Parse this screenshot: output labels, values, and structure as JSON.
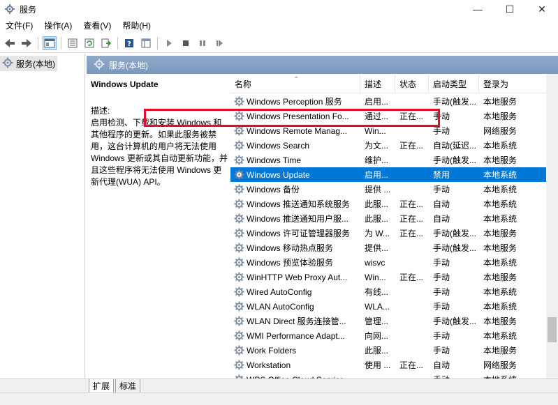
{
  "window": {
    "title": "服务",
    "controls": {
      "minimize": "—",
      "maximize": "☐",
      "close": "✕"
    }
  },
  "menu": [
    "文件(F)",
    "操作(A)",
    "查看(V)",
    "帮助(H)"
  ],
  "toolbar_icons": [
    "back-arrow-icon",
    "forward-arrow-icon",
    "console-tree-icon",
    "properties-icon",
    "refresh-icon",
    "export-icon",
    "help-icon",
    "view-icon",
    "play-icon",
    "stop-icon",
    "pause-icon",
    "restart-icon"
  ],
  "tree": {
    "root_label": "服务(本地)"
  },
  "panel": {
    "header_label": "服务(本地)",
    "selected_service": "Windows Update",
    "description_label": "描述:",
    "description_text": "启用检测、下载和安装 Windows 和其他程序的更新。如果此服务被禁用，这台计算机的用户将无法使用 Windows 更新或其自动更新功能，并且这些程序将无法使用 Windows 更新代理(WUA) API。"
  },
  "table": {
    "columns": [
      "名称",
      "描述",
      "状态",
      "启动类型",
      "登录为"
    ],
    "rows": [
      {
        "name": "Windows Perception 服务",
        "desc": "启用...",
        "status": "",
        "start": "手动(触发...",
        "logon": "本地服务"
      },
      {
        "name": "Windows Presentation Fo...",
        "desc": "通过...",
        "status": "正在...",
        "start": "手动",
        "logon": "本地服务"
      },
      {
        "name": "Windows Remote Manag...",
        "desc": "Win...",
        "status": "",
        "start": "手动",
        "logon": "网络服务"
      },
      {
        "name": "Windows Search",
        "desc": "为文...",
        "status": "正在...",
        "start": "自动(延迟...",
        "logon": "本地系统"
      },
      {
        "name": "Windows Time",
        "desc": "维护...",
        "status": "",
        "start": "手动(触发...",
        "logon": "本地服务"
      },
      {
        "name": "Windows Update",
        "desc": "启用...",
        "status": "",
        "start": "禁用",
        "logon": "本地系统"
      },
      {
        "name": "Windows 备份",
        "desc": "提供 ...",
        "status": "",
        "start": "手动",
        "logon": "本地系统"
      },
      {
        "name": "Windows 推送通知系统服务",
        "desc": "此服...",
        "status": "正在...",
        "start": "自动",
        "logon": "本地系统"
      },
      {
        "name": "Windows 推送通知用户服...",
        "desc": "此服...",
        "status": "正在...",
        "start": "自动",
        "logon": "本地系统"
      },
      {
        "name": "Windows 许可证管理器服务",
        "desc": "为 W...",
        "status": "正在...",
        "start": "手动(触发...",
        "logon": "本地服务"
      },
      {
        "name": "Windows 移动热点服务",
        "desc": "提供...",
        "status": "",
        "start": "手动(触发...",
        "logon": "本地服务"
      },
      {
        "name": "Windows 预览体验服务",
        "desc": "wisvc",
        "status": "",
        "start": "手动",
        "logon": "本地系统"
      },
      {
        "name": "WinHTTP Web Proxy Aut...",
        "desc": "Win...",
        "status": "正在...",
        "start": "手动",
        "logon": "本地服务"
      },
      {
        "name": "Wired AutoConfig",
        "desc": "有线...",
        "status": "",
        "start": "手动",
        "logon": "本地系统"
      },
      {
        "name": "WLAN AutoConfig",
        "desc": "WLA...",
        "status": "",
        "start": "手动",
        "logon": "本地系统"
      },
      {
        "name": "WLAN Direct 服务连接管...",
        "desc": "管理...",
        "status": "",
        "start": "手动(触发...",
        "logon": "本地服务"
      },
      {
        "name": "WMI Performance Adapt...",
        "desc": "向网...",
        "status": "",
        "start": "手动",
        "logon": "本地系统"
      },
      {
        "name": "Work Folders",
        "desc": "此服...",
        "status": "",
        "start": "手动",
        "logon": "本地服务"
      },
      {
        "name": "Workstation",
        "desc": "使用 ...",
        "status": "正在...",
        "start": "自动",
        "logon": "网络服务"
      },
      {
        "name": "WPS Office Cloud Service",
        "desc": "",
        "status": "",
        "start": "手动",
        "logon": "本地系统"
      }
    ],
    "selected_index": 5
  },
  "tabs": [
    "扩展",
    "标准"
  ],
  "colors": {
    "selection": "#0078d7",
    "highlight_box": "#e0102a",
    "panel_header": "#7b98bd"
  }
}
